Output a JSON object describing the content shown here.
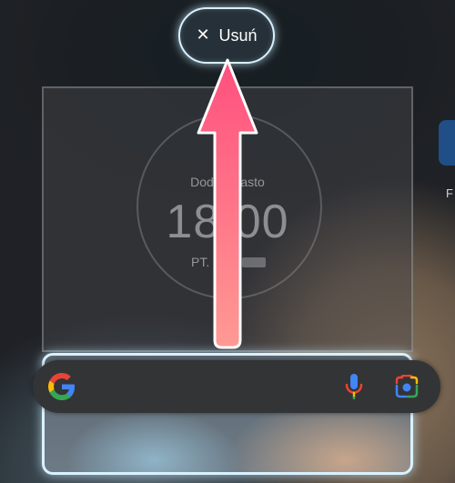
{
  "remove_button": {
    "label": "Usuń",
    "icon": "close-icon"
  },
  "clock_widget": {
    "city": "Dodaj miasto",
    "time": "18:00",
    "date": "PT."
  },
  "edge_app": {
    "label": "F"
  },
  "search_widget": {
    "icons": [
      "google-logo-icon",
      "microphone-icon",
      "google-lens-icon"
    ]
  },
  "colors": {
    "arrow_top": "#ff4f7e",
    "arrow_bottom": "#ff9a93",
    "highlight": "#d9f2ff",
    "search_bar": "#333436"
  }
}
